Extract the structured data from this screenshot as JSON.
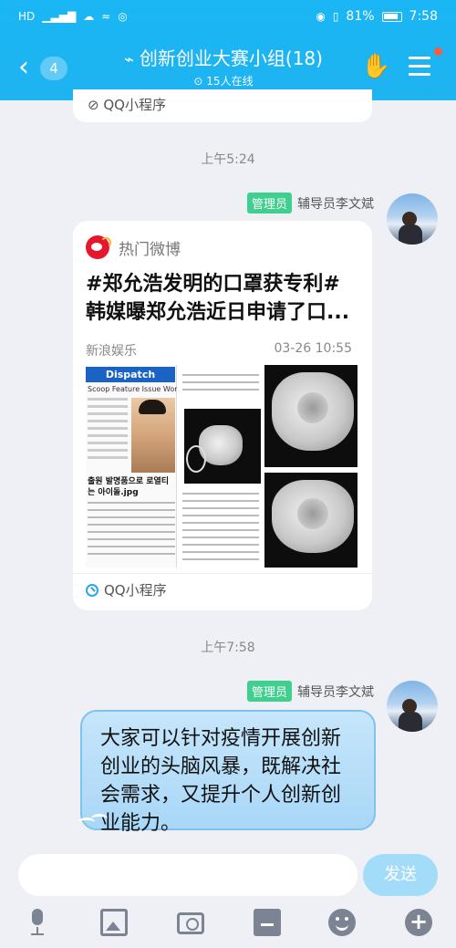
{
  "status_bar": {
    "left_icons": [
      "HD",
      "4G",
      "signal",
      "cloud",
      "nfc",
      "app"
    ],
    "battery_pct": "81%",
    "time": "7:58"
  },
  "header": {
    "back_icon": "back-chevron-icon",
    "unread_count": "4",
    "title": "创新创业大赛小组(18)",
    "online_status": "15人在线",
    "accent_color": "#1ab6f5"
  },
  "previous_card": {
    "mini_program_label": "QQ小程序"
  },
  "messages": [
    {
      "timestamp": "上午5:24",
      "sender_badge": "管理员",
      "sender_name": "辅导员李文斌",
      "type": "card",
      "card": {
        "source_app": "热门微博",
        "title_line1": "#郑允浩发明的口罩获专利#",
        "title_line2": "韩媒曝郑允浩近日申请了口...",
        "publisher": "新浪娱乐",
        "date": "03-26 10:55",
        "image_text": {
          "logo": "Dispatch",
          "nav": "Scoop  Feature  Issue  Wor",
          "headline": "출원 발명품으로 로열티 는 아이돌.jpg"
        },
        "mini_program_label": "QQ小程序"
      }
    },
    {
      "timestamp": "上午7:58",
      "sender_badge": "管理员",
      "sender_name": "辅导员李文斌",
      "type": "text",
      "lines": [
        "大家可以针对疫情开展创新",
        "创业的头脑风暴，既解决社",
        "会需求，又提升个人创新创",
        "业能力。"
      ]
    }
  ],
  "input": {
    "placeholder": "",
    "send_label": "发送"
  },
  "toolbar": [
    "microphone-icon",
    "image-icon",
    "camera-icon",
    "red-packet-icon",
    "emoji-icon",
    "plus-icon"
  ]
}
